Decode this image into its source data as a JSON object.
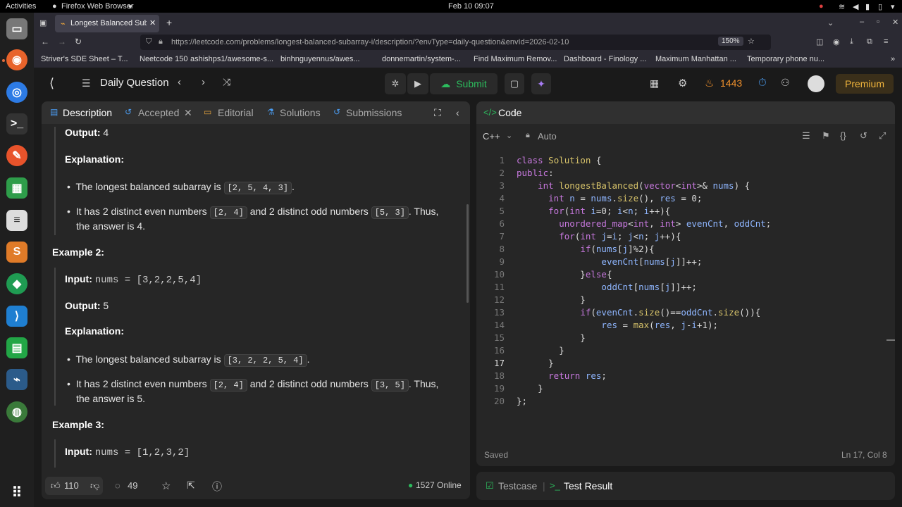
{
  "system": {
    "activities": "Activities",
    "app_name": "Firefox Web Browser",
    "datetime": "Feb 10  09:07"
  },
  "browser": {
    "tab_title": "Longest Balanced Subarr",
    "url": "https://leetcode.com/problems/longest-balanced-subarray-i/description/?envType=daily-question&envId=2026-02-10",
    "zoom": "150%",
    "bookmarks": [
      "Striver's SDE Sheet – T...",
      "Neetcode 150",
      "ashishps1/awesome-s...",
      "binhnguyennus/awes...",
      "donnemartin/system-...",
      "Find Maximum Remov...",
      "Dashboard - Finology ...",
      "Maximum Manhattan ...",
      "Temporary phone nu..."
    ]
  },
  "header": {
    "title": "Daily Question",
    "submit": "Submit",
    "streak": "1443",
    "premium": "Premium"
  },
  "left_tabs": {
    "description": "Description",
    "accepted": "Accepted",
    "editorial": "Editorial",
    "solutions": "Solutions",
    "submissions": "Submissions"
  },
  "description": {
    "ex1_output_label": "Output:",
    "ex1_output_value": "4",
    "explanation_label": "Explanation:",
    "ex1_b1_text": "The longest balanced subarray is",
    "ex1_b1_chip": "[2, 5, 4, 3]",
    "ex1_b2_pre": "It has 2 distinct even numbers",
    "ex1_b2_chip1": "[2, 4]",
    "ex1_b2_mid": "and 2 distinct odd numbers",
    "ex1_b2_chip2": "[5, 3]",
    "ex1_b2_post": ". Thus,",
    "ex1_b2_line2": "the answer is 4.",
    "ex2_title": "Example 2:",
    "input_label": "Input:",
    "ex2_input": "nums = [3,2,2,5,4]",
    "ex2_output_value": "5",
    "ex2_b1_chip": "[3, 2, 2, 5, 4]",
    "ex2_b2_chip1": "[2, 4]",
    "ex2_b2_chip2": "[3, 5]",
    "ex2_b2_line2": "the answer is 5.",
    "ex3_title": "Example 3:",
    "ex3_input": "nums = [1,2,3,2]"
  },
  "footer": {
    "likes": "110",
    "comments": "49",
    "online": "1527 Online"
  },
  "code_panel": {
    "title": "Code",
    "language": "C++",
    "mode": "Auto",
    "status": "Saved",
    "cursor": "Ln 17, Col 8",
    "lines": [
      "class Solution {",
      "public:",
      "    int longestBalanced(vector<int>& nums) {",
      "      int n = nums.size(), res = 0;",
      "      for(int i=0; i<n; i++){",
      "        unordered_map<int, int> evenCnt, oddCnt;",
      "        for(int j=i; j<n; j++){",
      "            if(nums[j]%2){",
      "                evenCnt[nums[j]]++;",
      "            }else{",
      "                oddCnt[nums[j]]++;",
      "            }",
      "            if(evenCnt.size()==oddCnt.size()){",
      "                res = max(res, j-i+1);",
      "            }",
      "        }",
      "      }",
      "      return res;",
      "    }",
      "};"
    ]
  },
  "bottom_tabs": {
    "testcase": "Testcase",
    "test_result": "Test Result"
  }
}
